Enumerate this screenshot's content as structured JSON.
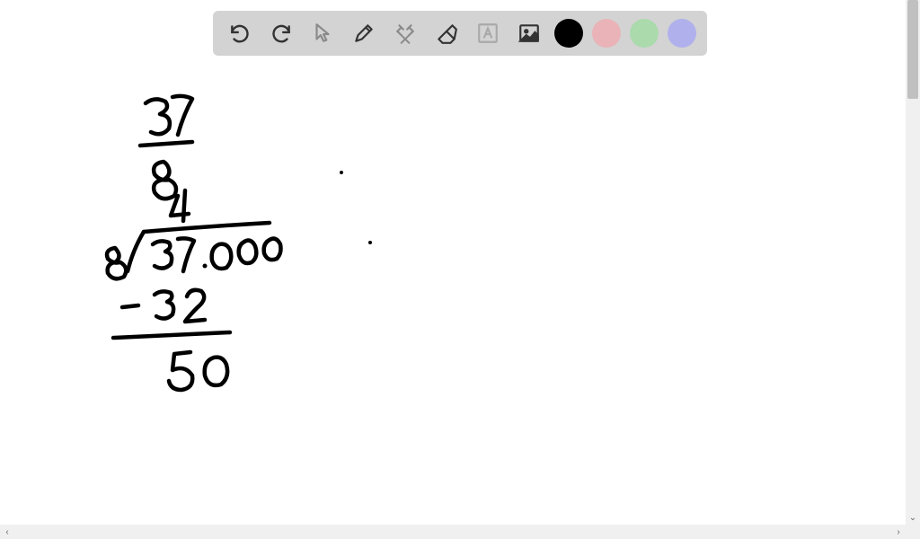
{
  "toolbar": {
    "tools": [
      {
        "name": "undo",
        "icon": "undo-icon"
      },
      {
        "name": "redo",
        "icon": "redo-icon"
      },
      {
        "name": "pointer",
        "icon": "pointer-icon"
      },
      {
        "name": "pen",
        "icon": "pen-icon"
      },
      {
        "name": "tools",
        "icon": "tools-icon"
      },
      {
        "name": "eraser",
        "icon": "eraser-icon"
      },
      {
        "name": "text",
        "icon": "text-icon"
      },
      {
        "name": "image",
        "icon": "image-icon"
      }
    ],
    "colors": {
      "black": "#000000",
      "pink": "#e9b3b7",
      "green": "#abdaac",
      "purple": "#b0b0ec"
    },
    "active_color": "black"
  },
  "canvas": {
    "content_description": "Handwritten math — fraction 37 over 8, long division 8 into 37.000, quotient digit 4, 37 minus 32 equals 5, bring down 0 to get 50",
    "strokes": {
      "fraction_numerator": "37",
      "fraction_denominator": "8",
      "quotient_partial": "4",
      "divisor": "8",
      "dividend": "37.000",
      "subtraction": "- 32",
      "remainder_line": "50"
    }
  }
}
